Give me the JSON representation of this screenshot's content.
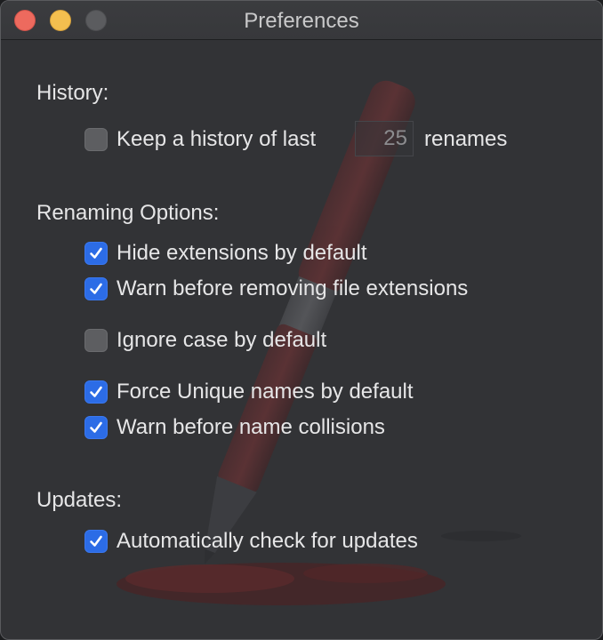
{
  "window": {
    "title": "Preferences"
  },
  "history": {
    "heading": "History:",
    "keep_history_label": "Keep a history of last",
    "keep_history_checked": false,
    "history_count": "25",
    "suffix_label": "renames"
  },
  "renaming": {
    "heading": "Renaming Options:",
    "options": [
      {
        "label": "Hide extensions by default",
        "checked": true
      },
      {
        "label": "Warn before removing file extensions",
        "checked": true
      },
      {
        "label": "Ignore case by default",
        "checked": false
      },
      {
        "label": "Force Unique names by default",
        "checked": true
      },
      {
        "label": "Warn before name collisions",
        "checked": true
      }
    ]
  },
  "updates": {
    "heading": "Updates:",
    "auto_check_label": "Automatically check for updates",
    "auto_check_checked": true
  },
  "icons": {
    "checkmark": "checkmark-icon",
    "background": "pen-ink-icon"
  },
  "colors": {
    "checkbox_on": "#2c6ce6",
    "close": "#ed6a5e",
    "minimize": "#f4bf4f"
  }
}
